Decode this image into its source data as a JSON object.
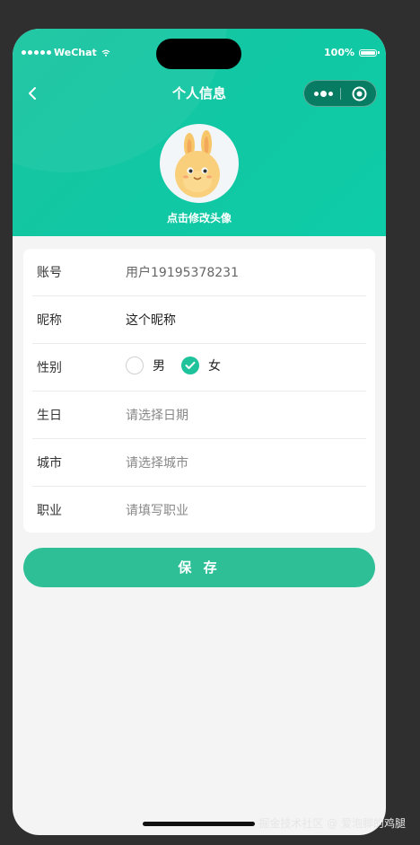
{
  "status_bar": {
    "carrier": "WeChat",
    "battery": "100%"
  },
  "nav": {
    "title": "个人信息"
  },
  "avatar": {
    "caption": "点击修改头像"
  },
  "form": {
    "account": {
      "label": "账号",
      "value": "用户19195378231"
    },
    "nickname": {
      "label": "昵称",
      "value": "这个昵称"
    },
    "gender": {
      "label": "性别",
      "options": [
        {
          "label": "男",
          "checked": false
        },
        {
          "label": "女",
          "checked": true
        }
      ]
    },
    "birthday": {
      "label": "生日",
      "placeholder": "请选择日期"
    },
    "city": {
      "label": "城市",
      "placeholder": "请选择城市"
    },
    "job": {
      "label": "职业",
      "placeholder": "请填写职业"
    }
  },
  "save_button": "保 存",
  "watermark": "掘金技术社区 @ 爱泡脚的鸡腿",
  "colors": {
    "header": "#10c8a4",
    "accent": "#2ebf97",
    "background": "#f4f4f4"
  }
}
